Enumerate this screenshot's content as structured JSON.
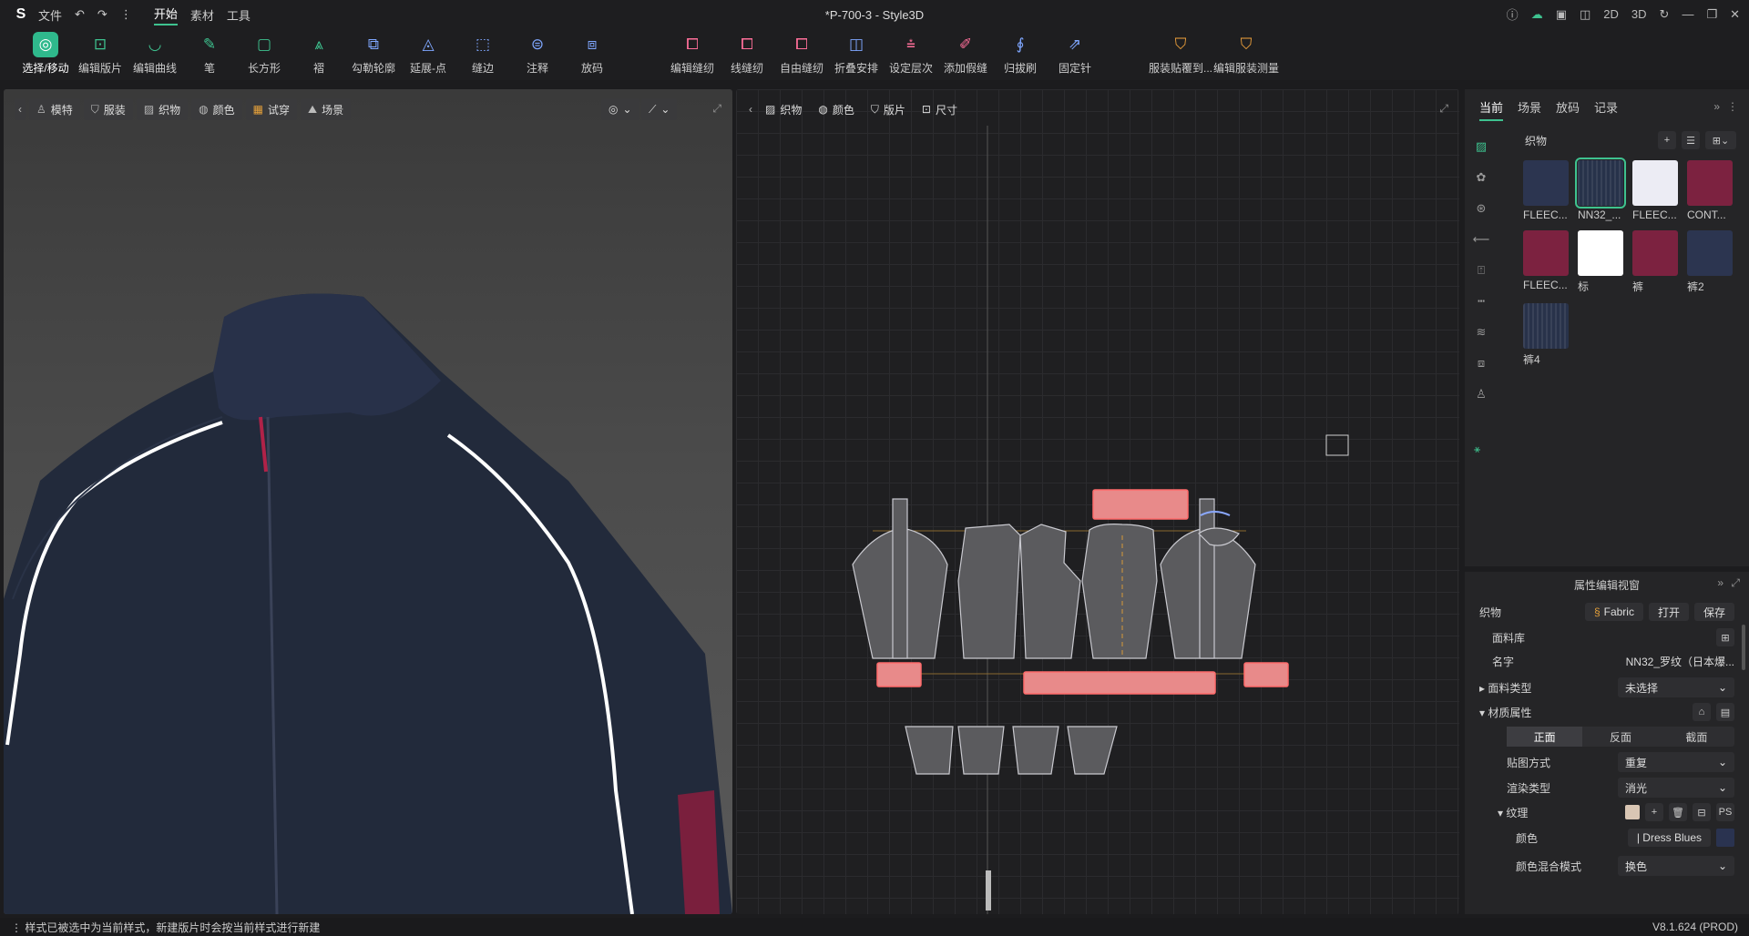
{
  "titlebar": {
    "menus": [
      {
        "label": "文件"
      },
      {
        "label": "开始"
      },
      {
        "label": "素材"
      },
      {
        "label": "工具"
      }
    ],
    "window_title": "*P-700-3 - Style3D",
    "view_modes": [
      "2D",
      "3D"
    ]
  },
  "toolbar": {
    "tools": [
      {
        "label": "选择/移动",
        "icon": "select-icon"
      },
      {
        "label": "编辑版片",
        "icon": "edit-pattern-icon"
      },
      {
        "label": "编辑曲线",
        "icon": "edit-curve-icon"
      },
      {
        "label": "笔",
        "icon": "pen-icon"
      },
      {
        "label": "长方形",
        "icon": "rectangle-icon"
      },
      {
        "label": "褶",
        "icon": "pleat-icon"
      },
      {
        "label": "勾勒轮廓",
        "icon": "trace-icon"
      },
      {
        "label": "延展-点",
        "icon": "extend-point-icon"
      },
      {
        "label": "缝边",
        "icon": "seam-allowance-icon"
      },
      {
        "label": "注释",
        "icon": "annotation-icon"
      },
      {
        "label": "放码",
        "icon": "grading-icon"
      }
    ],
    "tools2": [
      {
        "label": "编辑缝纫"
      },
      {
        "label": "线缝纫"
      },
      {
        "label": "自由缝纫"
      },
      {
        "label": "折叠安排"
      },
      {
        "label": "设定层次"
      },
      {
        "label": "添加假缝"
      },
      {
        "label": "归拔刷"
      },
      {
        "label": "固定针"
      }
    ],
    "tools3": [
      {
        "label": "服装贴覆到..."
      },
      {
        "label": "编辑服装测量"
      }
    ]
  },
  "view3d": {
    "buttons": [
      {
        "label": "模特"
      },
      {
        "label": "服装"
      },
      {
        "label": "织物"
      },
      {
        "label": "颜色"
      },
      {
        "label": "试穿"
      },
      {
        "label": "场景"
      }
    ]
  },
  "view2d": {
    "buttons": [
      {
        "label": "织物"
      },
      {
        "label": "颜色"
      },
      {
        "label": "版片"
      },
      {
        "label": "尺寸"
      }
    ]
  },
  "rpanel": {
    "tabs": [
      {
        "label": "当前"
      },
      {
        "label": "场景"
      },
      {
        "label": "放码"
      },
      {
        "label": "记录"
      }
    ],
    "section": "织物",
    "fabrics": [
      {
        "name": "FLEEC...",
        "color": "#2c3550"
      },
      {
        "name": "NN32_...",
        "color": "#27324a"
      },
      {
        "name": "FLEEC...",
        "color": "#ececf4"
      },
      {
        "name": "CONT...",
        "color": "#7c2240"
      },
      {
        "name": "FLEEC...",
        "color": "#7c2240"
      },
      {
        "name": "标",
        "color": "#ffffff"
      },
      {
        "name": "裤",
        "color": "#7c2240"
      },
      {
        "name": "裤2",
        "color": "#2c3550"
      },
      {
        "name": "裤4",
        "color": "#28324a"
      }
    ]
  },
  "props": {
    "title": "属性编辑视窗",
    "fabric_label": "织物",
    "fabric_tag": "Fabric",
    "open": "打开",
    "save": "保存",
    "library": "面料库",
    "name_label": "名字",
    "name_value": "NN32_罗纹（日本爆...",
    "type_label": "面料类型",
    "type_value": "未选择",
    "material_label": "材质属性",
    "faces": [
      "正面",
      "反面",
      "截面"
    ],
    "map_label": "贴图方式",
    "map_value": "重复",
    "render_label": "渲染类型",
    "render_value": "消光",
    "texture_label": "纹理",
    "color_label": "颜色",
    "color_value": "| Dress Blues",
    "blend_label": "颜色混合模式",
    "blend_value": "换色"
  },
  "status": {
    "message": "样式已被选中为当前样式，新建版片时会按当前样式进行新建",
    "version": "V8.1.624 (PROD)"
  }
}
